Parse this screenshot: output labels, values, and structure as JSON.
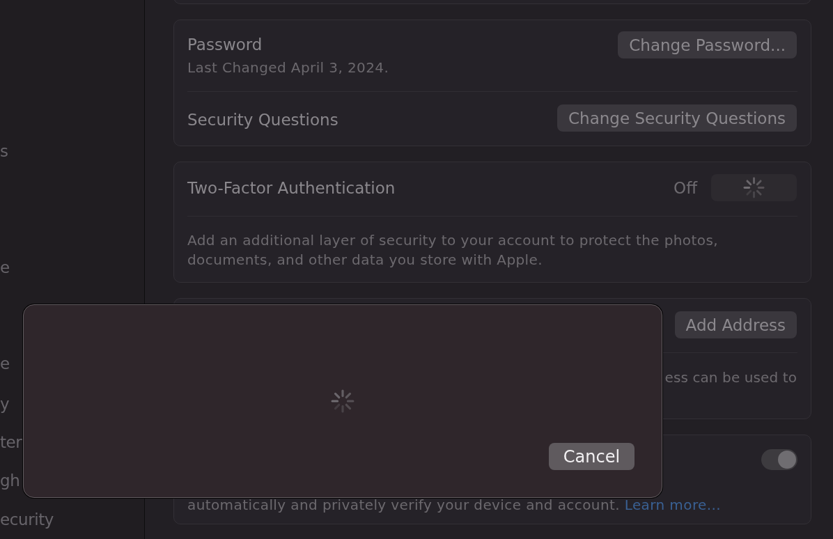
{
  "sidebar": {
    "items": [
      {
        "label": "s"
      },
      {
        "label": "e"
      },
      {
        "label": "e"
      },
      {
        "label": "y"
      },
      {
        "label": "ter"
      },
      {
        "label": "gh"
      },
      {
        "label": "ecurity"
      }
    ]
  },
  "groups": [
    {
      "rows": [
        {
          "kind": "action",
          "title": "Password",
          "subtitle": "Last Changed April 3, 2024.",
          "button": "Change Password..."
        },
        {
          "kind": "action",
          "title": "Security Questions",
          "button": "Change Security Questions"
        }
      ]
    },
    {
      "rows": [
        {
          "kind": "status",
          "title": "Two-Factor Authentication",
          "status": "Off",
          "loading": true
        },
        {
          "kind": "note",
          "text": "Add an additional layer of security to your account to protect the photos, documents, and other data you store with Apple."
        }
      ]
    },
    {
      "rows": [
        {
          "kind": "action",
          "button": "Add Address"
        },
        {
          "kind": "tail",
          "text": "ess can be used to"
        }
      ]
    },
    {
      "rows": [
        {
          "kind": "toggle",
          "on": true
        },
        {
          "kind": "footer",
          "text": "automatically and privately verify your device and account.",
          "link": "Learn more..."
        }
      ]
    }
  ],
  "dialog": {
    "loading": true,
    "buttons": [
      {
        "label": "Cancel"
      }
    ]
  }
}
